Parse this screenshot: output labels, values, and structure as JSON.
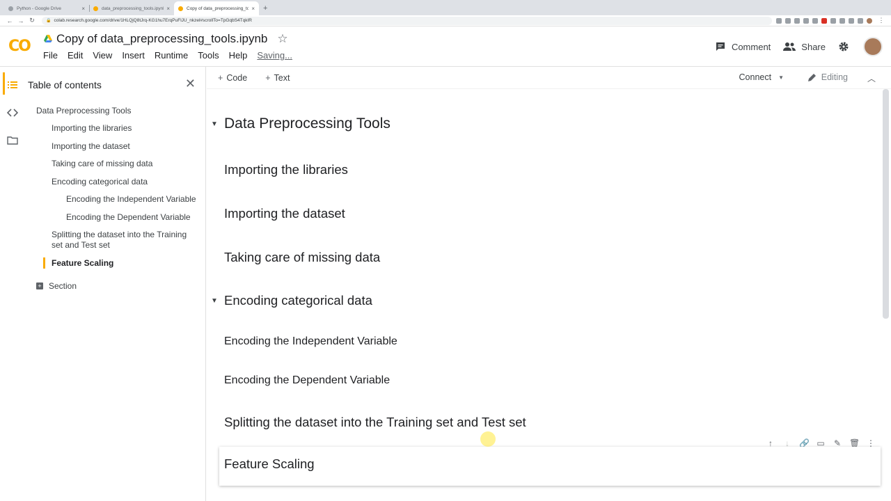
{
  "browser": {
    "tabs": [
      {
        "title": "Python - Google Drive",
        "active": false
      },
      {
        "title": "data_preprocessing_tools.ipynb",
        "active": false
      },
      {
        "title": "Copy of data_preprocessing_to",
        "active": true
      }
    ],
    "url": "colab.research.google.com/drive/1HLQjQ8tJrq-KG1hu7ErqPuFlJU_nkzel#scrollTo=TpGqbS4TqkIR"
  },
  "header": {
    "logo": "CO",
    "title": "Copy of data_preprocessing_tools.ipynb",
    "menu": [
      "File",
      "Edit",
      "View",
      "Insert",
      "Runtime",
      "Tools",
      "Help"
    ],
    "status": "Saving...",
    "comment_label": "Comment",
    "share_label": "Share"
  },
  "toolbar": {
    "code_label": "Code",
    "text_label": "Text",
    "connect_label": "Connect",
    "editing_label": "Editing"
  },
  "toc": {
    "title": "Table of contents",
    "items": [
      {
        "label": "Data Preprocessing Tools",
        "level": 1
      },
      {
        "label": "Importing the libraries",
        "level": 2
      },
      {
        "label": "Importing the dataset",
        "level": 2
      },
      {
        "label": "Taking care of missing data",
        "level": 2
      },
      {
        "label": "Encoding categorical data",
        "level": 2
      },
      {
        "label": "Encoding the Independent Variable",
        "level": 3
      },
      {
        "label": "Encoding the Dependent Variable",
        "level": 3
      },
      {
        "label": "Splitting the dataset into the Training set and Test set",
        "level": 2
      },
      {
        "label": "Feature Scaling",
        "level": 2,
        "active": true
      }
    ],
    "section_label": "Section"
  },
  "notebook": {
    "cells": [
      "Data Preprocessing Tools",
      "Importing the libraries",
      "Importing the dataset",
      "Taking care of missing data",
      "Encoding categorical data",
      "Encoding the Independent Variable",
      "Encoding the Dependent Variable",
      "Splitting the dataset into the Training set and Test set",
      "Feature Scaling"
    ]
  },
  "colors": {
    "accent": "#f9ab00",
    "text": "#202124",
    "muted": "#5f6368"
  }
}
